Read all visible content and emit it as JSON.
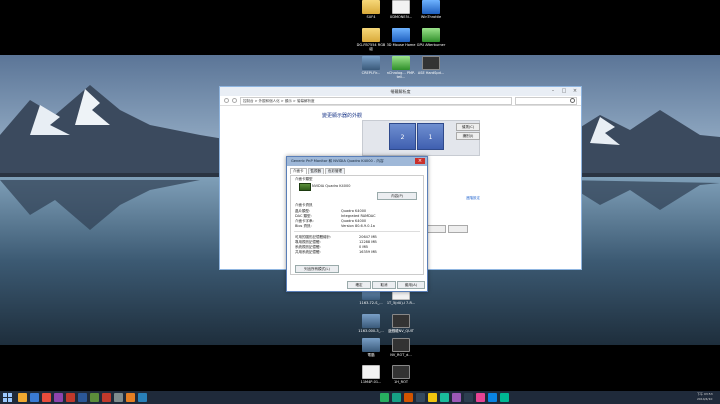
{
  "desktop": {
    "icons": [
      {
        "label": "SUF4",
        "kind": "folder"
      },
      {
        "label": "UDMONE5I...",
        "kind": "doc"
      },
      {
        "label": "WinThrottle",
        "kind": "app"
      },
      {
        "label": "DG-FB7554 RGB組",
        "kind": "folder"
      },
      {
        "label": "3D Mouse Home",
        "kind": "app"
      },
      {
        "label": "GPU Afterburner",
        "kind": "green"
      },
      {
        "label": "CREPI-Fir...",
        "kind": "pic"
      },
      {
        "label": "nChrolog... PMP-tell...",
        "kind": "green"
      },
      {
        "label": "ASE HardSpd...",
        "kind": "dark"
      },
      {
        "label": "1163-72-S_...",
        "kind": "pic"
      },
      {
        "label": "1T_5(dU)-i 7-R...",
        "kind": "doc"
      },
      {
        "label": "1163-000-3_...",
        "kind": "pic"
      },
      {
        "label": "遊戲龍NV_QUIT",
        "kind": "dark"
      },
      {
        "label": "電腦",
        "kind": "pic"
      },
      {
        "label": "NV_ROT_d...",
        "kind": "dark"
      },
      {
        "label": "11M4P-01...",
        "kind": "doc"
      },
      {
        "label": "1H_ROT",
        "kind": "dark"
      }
    ]
  },
  "display_window": {
    "title": "螢幕解析度",
    "breadcrumb": "控制台 > 外觀和個人化 > 顯示 > 螢幕解析度",
    "heading": "變更顯示器的外觀",
    "monitors": [
      "2",
      "1"
    ],
    "detect_label": "偵測(C)",
    "identify_label": "識別(I)",
    "advanced_link": "進階設定"
  },
  "properties_dialog": {
    "title": "Generic PnP Monitor 和 NVIDIA Quadro K4000 - 內容",
    "tabs": [
      "介面卡",
      "監視器",
      "色彩管理"
    ],
    "adapter_type_label": "介面卡類型",
    "adapter_name": "NVIDIA Quadro K4000",
    "properties_button": "內容(P)",
    "info_title": "介面卡資訊",
    "info_rows": [
      {
        "key": "晶片類型:",
        "value": "Quadro K4000"
      },
      {
        "key": "DAC 類型:",
        "value": "Integrated RAMDAC"
      },
      {
        "key": "介面卡字串:",
        "value": "Quadro K4000"
      },
      {
        "key": "Bios 資訊:",
        "value": "Version 80.6.9.0.1a"
      }
    ],
    "memory_rows": [
      {
        "key": "可用的圖形記憶體總計:",
        "value": "20647 MB"
      },
      {
        "key": "專用視訊記憶體:",
        "value": "12288 MB"
      },
      {
        "key": "系統視訊記憶體:",
        "value": "0 MB"
      },
      {
        "key": "共用系統記憶體:",
        "value": "16359 MB"
      }
    ],
    "list_modes_button": "列出所有模式(L)",
    "ok_button": "確定",
    "cancel_button": "取消",
    "apply_button": "套用(A)"
  },
  "taskbar": {
    "clock_time": "下午 03:53",
    "clock_date": "2014/4/10"
  },
  "colors": {
    "taskbar": "#1f2a3a",
    "accent": "#2a6ad0"
  }
}
